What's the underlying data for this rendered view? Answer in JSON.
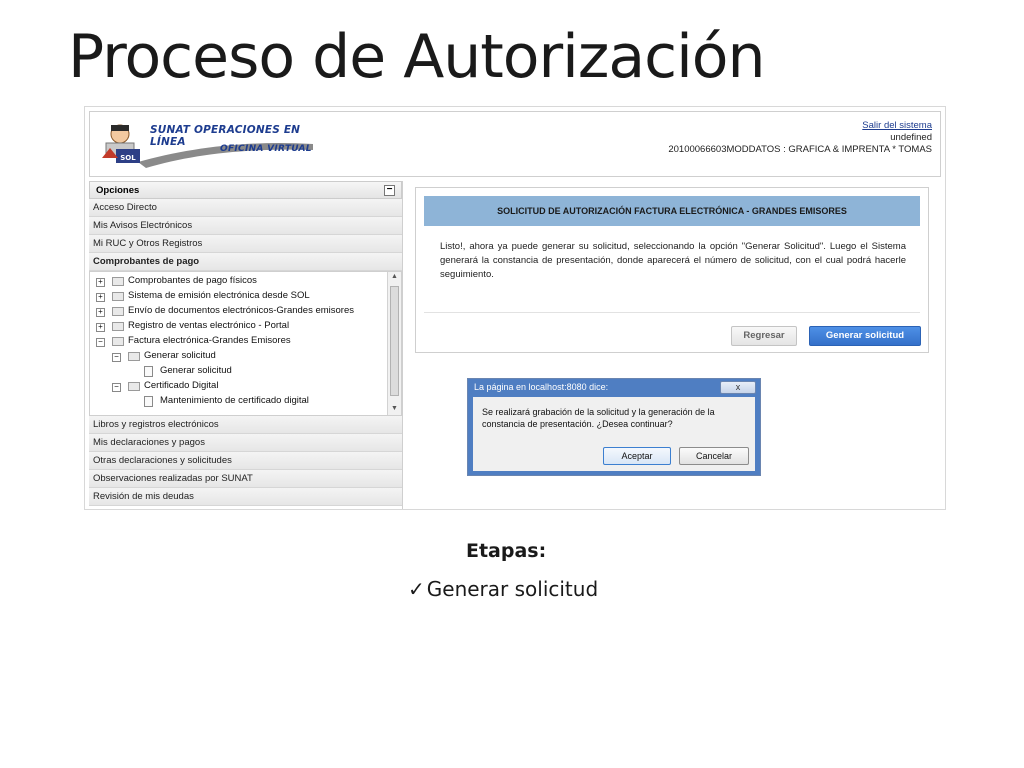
{
  "slide": {
    "title": "Proceso de Autorización",
    "etapas_label": "Etapas:",
    "check_mark": "✓",
    "step": "Generar solicitud"
  },
  "header": {
    "logo_title": "SUNAT OPERACIONES EN LÍNEA",
    "logo_subtitle": "OFICINA VIRTUAL",
    "logo_badge": "SOL",
    "logout_link": "Salir del sistema",
    "user_line1": "undefined",
    "user_line2": "20100066603MODDATOS : GRAFICA & IMPRENTA * TOMAS"
  },
  "sidebar": {
    "header": "Opciones",
    "collapse_symbol": "−",
    "top_items": [
      "Acceso Directo",
      "Mis Avisos Electrónicos",
      "Mi RUC y Otros Registros",
      "Comprobantes de pago"
    ],
    "tree": [
      {
        "label": "Comprobantes de pago físicos",
        "toggle": "+"
      },
      {
        "label": "Sistema de emisión electrónica desde SOL",
        "toggle": "+"
      },
      {
        "label": "Envío de documentos electrónicos-Grandes emisores",
        "toggle": "+"
      },
      {
        "label": "Registro de ventas electrónico - Portal",
        "toggle": "+"
      },
      {
        "label": "Factura electrónica-Grandes Emisores",
        "toggle": "−"
      },
      {
        "label": "Generar solicitud",
        "toggle": "−"
      },
      {
        "label": "Generar solicitud"
      },
      {
        "label": "Certificado Digital",
        "toggle": "−"
      },
      {
        "label": "Mantenimiento de certificado digital"
      }
    ],
    "bottom_items": [
      "Libros y registros electrónicos",
      "Mis declaraciones y pagos",
      "Otras declaraciones y solicitudes",
      "Observaciones realizadas por SUNAT",
      "Revisión de mis deudas"
    ]
  },
  "panel": {
    "title": "SOLICITUD DE AUTORIZACIÓN FACTURA ELECTRÓNICA - GRANDES EMISORES",
    "message": "Listo!, ahora ya puede generar su solicitud, seleccionando la opción \"Generar Solicitud\". Luego el Sistema generará la constancia de presentación, donde aparecerá el número de solicitud, con el cual podrá hacerle seguimiento.",
    "back_button": "Regresar",
    "generate_button": "Generar solicitud"
  },
  "dialog": {
    "title": "La página en localhost:8080 dice:",
    "close": "x",
    "message": "Se realizará grabación de la solicitud y la generación de la constancia de presentación. ¿Desea continuar?",
    "ok": "Aceptar",
    "cancel": "Cancelar"
  },
  "colors": {
    "panel_title_bg": "#8eb4d7",
    "primary_button": "#3d7cd6",
    "dialog_frame": "#4f7ec2",
    "logo_blue": "#1d3c8f"
  }
}
